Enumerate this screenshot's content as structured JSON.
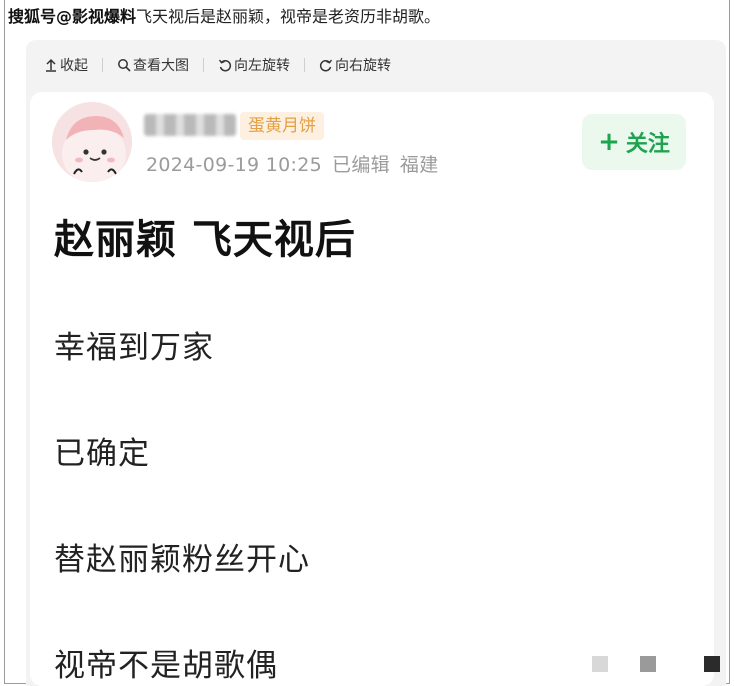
{
  "caption": {
    "source": "搜狐号@影视爆料",
    "text": "飞天视后是赵丽颖，视帝是老资历非胡歌。"
  },
  "toolbar": {
    "collapse_label": "收起",
    "view_large_label": "查看大图",
    "rotate_left_label": "向左旋转",
    "rotate_right_label": "向右旋转"
  },
  "post": {
    "badge": "蛋黄月饼",
    "timestamp": "2024-09-19 10:25",
    "edited": "已编辑",
    "location": "福建",
    "follow_label": "关注",
    "title": "赵丽颖 飞天视后",
    "lines": [
      "幸福到万家",
      "已确定",
      "替赵丽颖粉丝开心",
      "视帝不是胡歌偶"
    ]
  },
  "colors": {
    "follow_green": "#1ea34e",
    "badge_orange": "#e4a045",
    "meta_gray": "#9b9b9b"
  },
  "icons": {
    "collapse": "arrow-up-icon",
    "view_large": "magnifier-icon",
    "rotate_left": "rotate-left-icon",
    "rotate_right": "rotate-right-icon"
  }
}
